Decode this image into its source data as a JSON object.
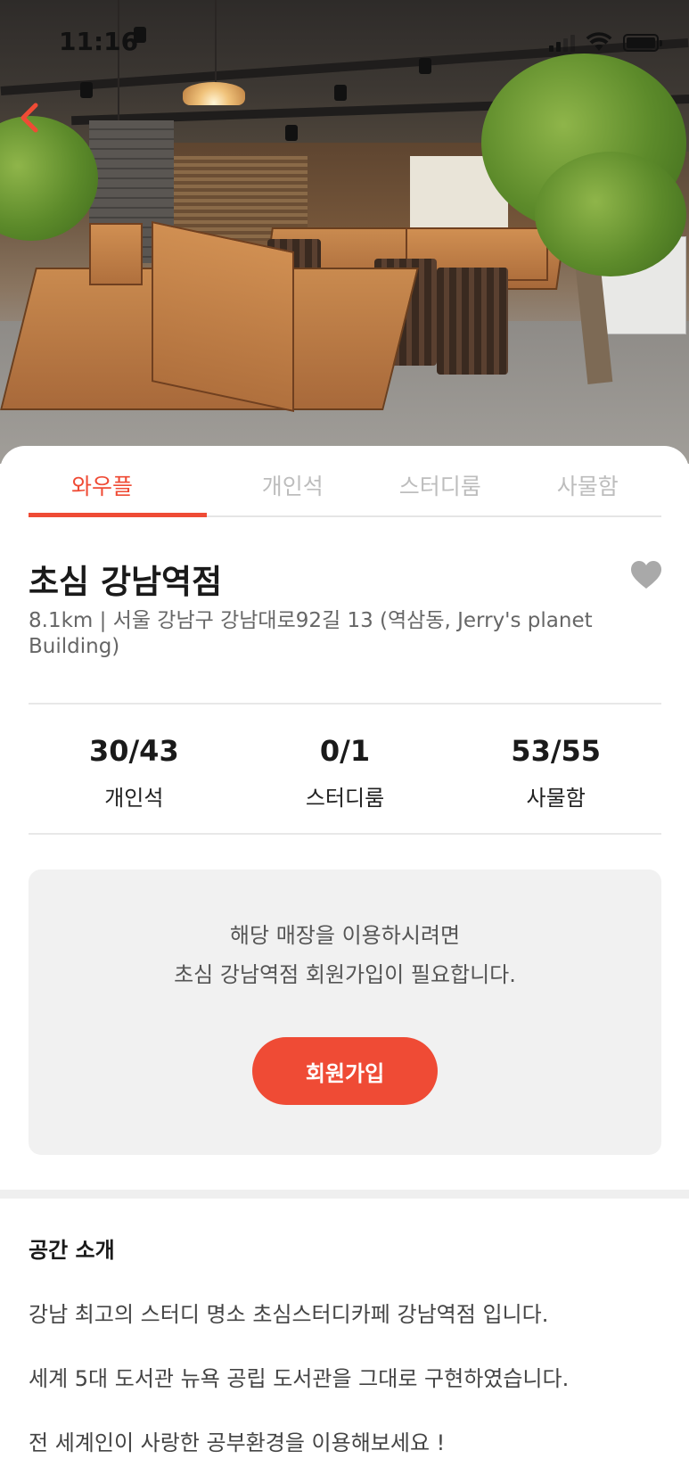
{
  "status_bar": {
    "time": "11:16"
  },
  "icons": {
    "back": "chevron-left-icon",
    "favorite": "heart-icon",
    "signal": "cellular-signal-icon",
    "wifi": "wifi-icon",
    "battery": "battery-icon"
  },
  "colors": {
    "accent": "#ef4b35",
    "inactive_tab": "#bdbdbd",
    "heart": "#a9a9a9",
    "box_bg": "#f1f1f1"
  },
  "tabs": [
    {
      "label": "와우플",
      "active": true
    },
    {
      "label": "개인석",
      "active": false
    },
    {
      "label": "스터디룸",
      "active": false
    },
    {
      "label": "사물함",
      "active": false
    }
  ],
  "store": {
    "name": "초심 강남역점",
    "address": "8.1km | 서울 강남구 강남대로92길 13 (역삼동, Jerry's planet Building)"
  },
  "stats": [
    {
      "value": "30/43",
      "label": "개인석"
    },
    {
      "value": "0/1",
      "label": "스터디룸"
    },
    {
      "value": "53/55",
      "label": "사물함"
    }
  ],
  "join": {
    "message_line1": "해당 매장을 이용하시려면",
    "message_line2": "초심 강남역점 회원가입이 필요합니다.",
    "button_label": "회원가입"
  },
  "intro": {
    "title": "공간 소개",
    "lines": [
      "강남 최고의 스터디 명소 초심스터디카페 강남역점 입니다.",
      " 세계 5대 도서관 뉴욕 공립 도서관을 그대로 구현하였습니다.",
      " 전 세계인이 사랑한 공부환경을 이용해보세요 !"
    ]
  }
}
